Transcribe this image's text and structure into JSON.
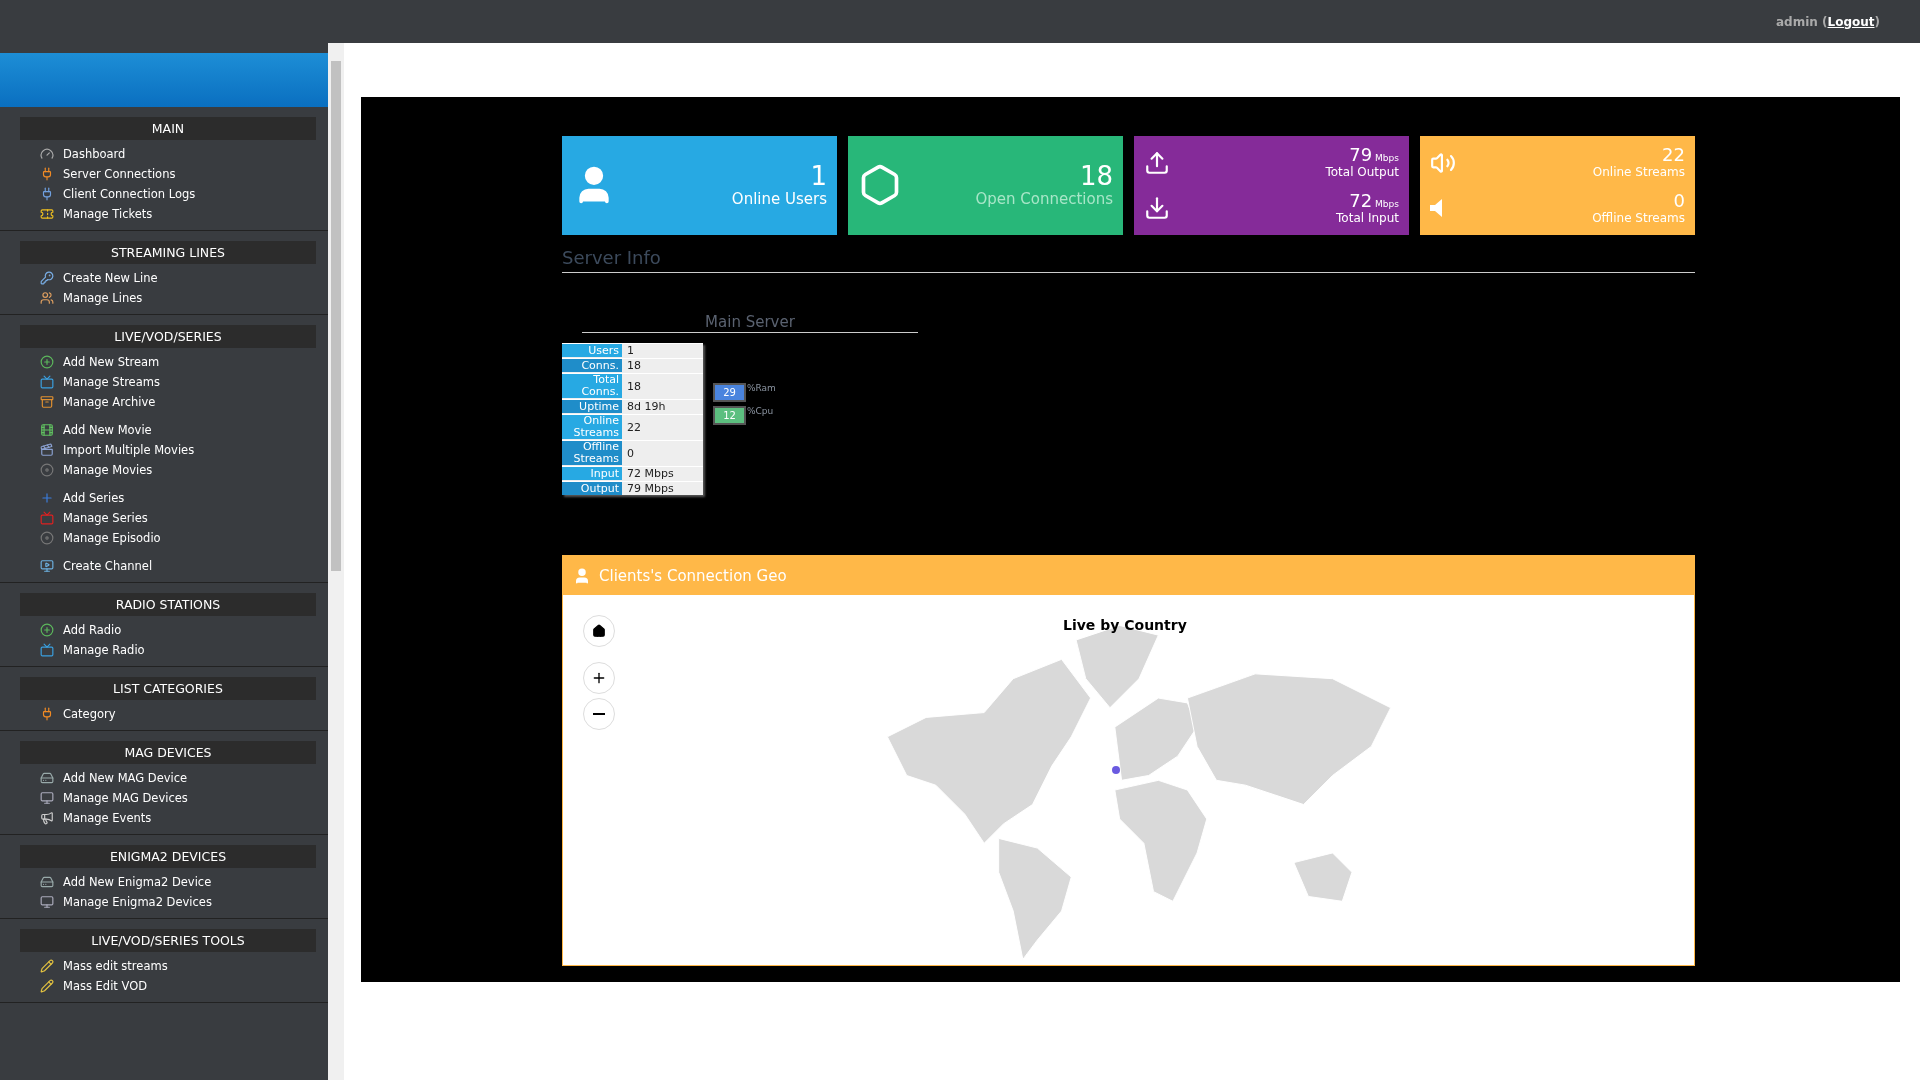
{
  "topbar": {
    "user": "admin (",
    "logout": "Logout",
    "suffix": ")"
  },
  "sidebar": {
    "sections": [
      {
        "title": "MAIN",
        "groups": [
          [
            {
              "label": "Dashboard"
            },
            {
              "label": "Server Connections"
            },
            {
              "label": "Client Connection Logs"
            },
            {
              "label": "Manage Tickets"
            }
          ]
        ]
      },
      {
        "title": "STREAMING LINES",
        "groups": [
          [
            {
              "label": "Create New Line"
            },
            {
              "label": "Manage Lines"
            }
          ]
        ]
      },
      {
        "title": "LIVE/VOD/SERIES",
        "groups": [
          [
            {
              "label": "Add New Stream"
            },
            {
              "label": "Manage Streams"
            },
            {
              "label": "Manage Archive"
            }
          ],
          [
            {
              "label": "Add New Movie"
            },
            {
              "label": "Import Multiple Movies"
            },
            {
              "label": "Manage Movies"
            }
          ],
          [
            {
              "label": "Add Series"
            },
            {
              "label": "Manage Series"
            },
            {
              "label": "Manage Episodio"
            }
          ],
          [
            {
              "label": "Create Channel"
            }
          ]
        ]
      },
      {
        "title": "RADIO STATIONS",
        "groups": [
          [
            {
              "label": "Add Radio"
            },
            {
              "label": "Manage Radio"
            }
          ]
        ]
      },
      {
        "title": "LIST CATEGORIES",
        "groups": [
          [
            {
              "label": "Category"
            }
          ]
        ]
      },
      {
        "title": "MAG DEVICES",
        "groups": [
          [
            {
              "label": "Add New MAG Device"
            },
            {
              "label": "Manage MAG Devices"
            },
            {
              "label": "Manage Events"
            }
          ]
        ]
      },
      {
        "title": "ENIGMA2 DEVICES",
        "groups": [
          [
            {
              "label": "Add New Enigma2 Device"
            },
            {
              "label": "Manage Enigma2 Devices"
            }
          ]
        ]
      },
      {
        "title": "LIVE/VOD/SERIES TOOLS",
        "groups": [
          [
            {
              "label": "Mass edit streams"
            },
            {
              "label": "Mass Edit VOD"
            }
          ]
        ]
      }
    ]
  },
  "tiles": [
    {
      "color": "#27a9e3",
      "rows": [
        {
          "value": "1",
          "label": "Online Users"
        }
      ]
    },
    {
      "color": "#28b779",
      "rows": [
        {
          "value": "18",
          "label": "Open Connections"
        }
      ]
    },
    {
      "color": "#852b99",
      "rows": [
        {
          "value": "79",
          "unit": "Mbps",
          "label": "Total Output"
        },
        {
          "value": "72",
          "unit": "Mbps",
          "label": "Total Input"
        }
      ]
    },
    {
      "color": "#ffb848",
      "rows": [
        {
          "value": "22",
          "label": "Online Streams"
        },
        {
          "value": "0",
          "label": "Offline Streams"
        }
      ]
    }
  ],
  "server_info": {
    "title": "Server Info",
    "server_name": "Main Server",
    "rows": [
      {
        "label": "Users",
        "value": "1"
      },
      {
        "label": "Conns.",
        "value": "18"
      },
      {
        "label": "Total Conns.",
        "value": "18"
      },
      {
        "label": "Uptime",
        "value": "8d 19h"
      },
      {
        "label": "Online Streams",
        "value": "22"
      },
      {
        "label": "Offline Streams",
        "value": "0"
      },
      {
        "label": "Input",
        "value": "72 Mbps"
      },
      {
        "label": "Output",
        "value": "79 Mbps"
      }
    ],
    "meters": [
      {
        "value": "29",
        "label": "%Ram",
        "color": "#4a84de"
      },
      {
        "value": "12",
        "label": "%Cpu",
        "color": "#5cbf7f"
      }
    ]
  },
  "geo": {
    "title": "Clients's Connection Geo",
    "map_title": "Live by Country"
  }
}
